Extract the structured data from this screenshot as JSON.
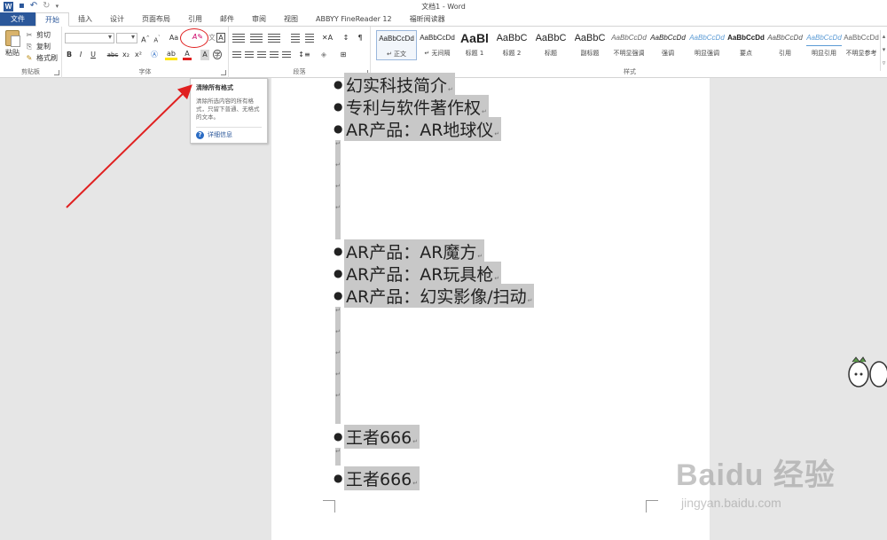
{
  "window": {
    "title": "文档1 - Word"
  },
  "tabs": [
    "文件",
    "开始",
    "插入",
    "设计",
    "页面布局",
    "引用",
    "邮件",
    "审阅",
    "视图",
    "ABBYY FineReader 12",
    "福昕阅读器"
  ],
  "clipboard": {
    "paste": "粘贴",
    "cut": "剪切",
    "copy": "复制",
    "format_painter": "格式刷",
    "label": "剪贴板"
  },
  "font": {
    "label": "字体",
    "case_btn": "Aa",
    "bold": "B",
    "italic": "I",
    "underline": "U",
    "strike": "abc",
    "sub": "x₂",
    "sup": "x²",
    "text_color_btn": "A"
  },
  "paragraph": {
    "label": "段落"
  },
  "styles": {
    "label": "样式",
    "items": [
      {
        "preview": "AaBbCcDd",
        "name": "↵ 正文"
      },
      {
        "preview": "AaBbCcDd",
        "name": "↵ 无间隔"
      },
      {
        "preview": "AaBl",
        "name": "标题 1"
      },
      {
        "preview": "AaBbC",
        "name": "标题 2"
      },
      {
        "preview": "AaBbC",
        "name": "标题"
      },
      {
        "preview": "AaBbC",
        "name": "副标题"
      },
      {
        "preview": "AaBbCcDd",
        "name": "不明显强调"
      },
      {
        "preview": "AaBbCcDd",
        "name": "强调"
      },
      {
        "preview": "AaBbCcDd",
        "name": "明显强调"
      },
      {
        "preview": "AaBbCcDd",
        "name": "要点"
      },
      {
        "preview": "AaBbCcDd",
        "name": "引用"
      },
      {
        "preview": "AaBbCcDd",
        "name": "明显引用"
      },
      {
        "preview": "AaBbCcDd",
        "name": "不明显参考"
      }
    ]
  },
  "tooltip": {
    "title": "清除所有格式",
    "desc": "清除所选内容的所有格式，只留下普通、无格式的文本。",
    "more": "详细信息"
  },
  "document": {
    "lines": [
      "幻实科技简介",
      "专利与软件著作权",
      "AR产品：AR地球仪",
      "AR产品：AR魔方",
      "AR产品：AR玩具枪",
      "AR产品：幻实影像/扫动",
      "王者666",
      "王者666"
    ]
  },
  "watermark": {
    "main": "Baidu 经验",
    "sub": "jingyan.baidu.com"
  },
  "colors": {
    "accent": "#2b579a",
    "selection": "#c8c8c8",
    "annotation": "#e02020"
  }
}
